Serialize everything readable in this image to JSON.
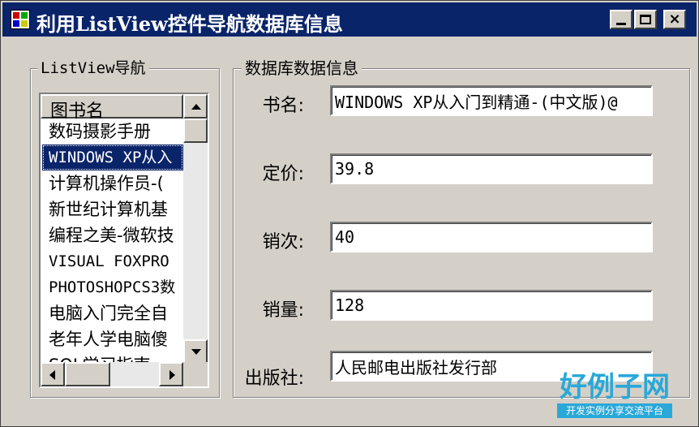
{
  "window": {
    "title": "利用ListView控件导航数据库信息",
    "minimize_glyph": "_",
    "close_glyph": "×"
  },
  "left_group": {
    "title": "ListView导航",
    "column_header": "图书名",
    "items": [
      "数码摄影手册",
      "WINDOWS XP从入",
      "计算机操作员-(",
      "新世纪计算机基",
      "编程之美-微软技",
      "VISUAL FOXPRO",
      "PHOTOSHOPCS3数",
      "电脑入门完全自",
      "老年人学电脑傻",
      "SQL学习指南"
    ],
    "selected_index": 1
  },
  "right_group": {
    "title": "数据库数据信息",
    "fields": [
      {
        "label": "书名:",
        "value": "WINDOWS XP从入门到精通-(中文版)@"
      },
      {
        "label": "定价:",
        "value": "39.8"
      },
      {
        "label": "销次:",
        "value": "40"
      },
      {
        "label": "销量:",
        "value": "128"
      },
      {
        "label": "出版社:",
        "value": "人民邮电出版社发行部"
      }
    ]
  },
  "watermark": {
    "main": "好例子网",
    "sub": "开发实例分享交流平台"
  }
}
